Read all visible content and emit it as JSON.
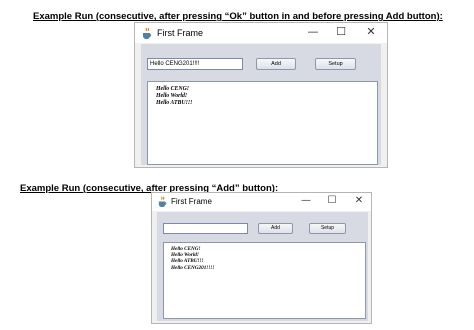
{
  "captions": {
    "first": "Example Run (consecutive, after pressing “Ok” button in and before pressing Add button):",
    "second": "Example Run (consecutive, after pressing “Add” button):"
  },
  "window1": {
    "title": "First Frame",
    "app_icon": "java-cup-icon",
    "controls": {
      "minimize": "—",
      "maximize": "☐",
      "close": "✕"
    },
    "input_value": "Hello CENG201!!!!",
    "add_label": "Add",
    "setup_label": "Setup",
    "lines": [
      "Hello CENG!",
      "Hello World!",
      "Hello ATBU!!!"
    ]
  },
  "window2": {
    "title": "First Frame",
    "app_icon": "java-cup-icon",
    "controls": {
      "minimize": "—",
      "maximize": "☐",
      "close": "✕"
    },
    "input_value": "",
    "add_label": "Add",
    "setup_label": "Setup",
    "lines": [
      "Hello CENG!",
      "Hello World!",
      "Hello ATBU!!!",
      "Hello CENG201!!!!"
    ]
  }
}
